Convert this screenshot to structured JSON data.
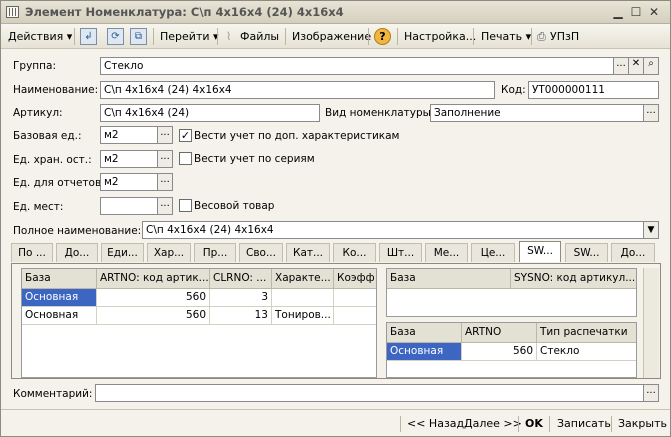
{
  "window": {
    "title": "Элемент Номенклатура: С\\п 4х16х4 (24) 4х16х4"
  },
  "toolbar": {
    "actions": "Действия",
    "goto": "Перейти",
    "files": "Файлы",
    "image": "Изображение",
    "help": "?",
    "settings": "Настройка...",
    "print": "Печать",
    "upzp": "УПзП"
  },
  "form": {
    "group_label": "Группа:",
    "group_value": "Стекло",
    "name_label": "Наименование:",
    "name_value": "С\\п 4х16х4 (24) 4х16х4",
    "code_label": "Код:",
    "code_value": "УТ000000111",
    "article_label": "Артикул:",
    "article_value": "С\\п 4х16х4 (24)",
    "kind_label": "Вид номенклатуры:",
    "kind_value": "Заполнение",
    "base_unit_label": "Базовая ед.:",
    "base_unit_value": "м2",
    "storage_unit_label": "Ед. хран. ост.:",
    "storage_unit_value": "м2",
    "report_unit_label": "Ед. для отчетов:",
    "report_unit_value": "м2",
    "places_unit_label": "Ед. мест:",
    "places_unit_value": "",
    "chk_characteristics": "Вести учет по доп. характеристикам",
    "chk_characteristics_checked": true,
    "chk_series": "Вести учет по сериям",
    "chk_series_checked": false,
    "chk_weight": "Весовой товар",
    "chk_weight_checked": false,
    "full_name_label": "Полное наименование:",
    "full_name_value": "С\\п 4х16х4 (24) 4х16х4",
    "comment_label": "Комментарий:",
    "comment_value": ""
  },
  "tabs": [
    "По ...",
    "До...",
    "Еди...",
    "Хар...",
    "Пр...",
    "Сво...",
    "Кат...",
    "Ко...",
    "Шт...",
    "Ме...",
    "Це...",
    "SW...",
    "SW...",
    "До..."
  ],
  "active_tab_index": 11,
  "grid_left": {
    "headers": [
      "База",
      "ARTNO: код артик...",
      "CLRNO: ...",
      "Характе...",
      "Коэфф"
    ],
    "rows": [
      [
        "Основная",
        "560",
        "3",
        "",
        ""
      ],
      [
        "Основная",
        "560",
        "13",
        "Тониров...",
        ""
      ]
    ]
  },
  "grid_right_top": {
    "headers": [
      "База",
      "SYSNO: код артикул..."
    ]
  },
  "grid_right_bottom": {
    "headers": [
      "База",
      "ARTNO",
      "Тип распечатки"
    ],
    "rows": [
      [
        "Основная",
        "560",
        "Стекло"
      ]
    ]
  },
  "bottom": {
    "back": "<< Назад",
    "next": "Далее >>",
    "ok": "OK",
    "save": "Записать",
    "close": "Закрыть"
  },
  "colors": {
    "selection": "#3c66c1",
    "window_bg": "#f4f2ea"
  }
}
